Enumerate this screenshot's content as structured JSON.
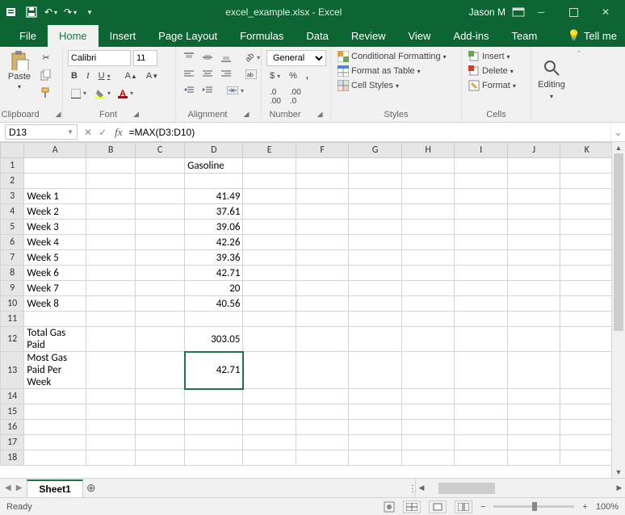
{
  "titlebar": {
    "title": "excel_example.xlsx - Excel",
    "user": "Jason M"
  },
  "tabs": {
    "file": "File",
    "home": "Home",
    "insert": "Insert",
    "pagelayout": "Page Layout",
    "formulas": "Formulas",
    "data": "Data",
    "review": "Review",
    "view": "View",
    "addins": "Add-ins",
    "team": "Team",
    "tellme": "Tell me"
  },
  "ribbon": {
    "clipboard": {
      "label": "Clipboard",
      "paste": "Paste"
    },
    "font": {
      "label": "Font",
      "name": "Calibri",
      "size": "11",
      "bold": "B",
      "italic": "I",
      "underline": "U"
    },
    "alignment": {
      "label": "Alignment"
    },
    "number": {
      "label": "Number",
      "format": "General"
    },
    "styles": {
      "label": "Styles",
      "cond": "Conditional Formatting",
      "table": "Format as Table",
      "cell": "Cell Styles"
    },
    "cells": {
      "label": "Cells",
      "insert": "Insert",
      "delete": "Delete",
      "format": "Format"
    },
    "editing": {
      "label": "Editing"
    }
  },
  "formula_bar": {
    "name_box": "D13",
    "fx": "fx",
    "formula": "=MAX(D3:D10)"
  },
  "columns": [
    "A",
    "B",
    "C",
    "D",
    "E",
    "F",
    "G",
    "H",
    "I",
    "J",
    "K"
  ],
  "rows": [
    1,
    2,
    3,
    4,
    5,
    6,
    7,
    8,
    9,
    10,
    11,
    12,
    13,
    14,
    15,
    16,
    17,
    18
  ],
  "cell_data": {
    "D1": "Gasoline",
    "A3": "Week 1",
    "D3": "41.49",
    "A4": "Week 2",
    "D4": "37.61",
    "A5": "Week 3",
    "D5": "39.06",
    "A6": "Week 4",
    "D6": "42.26",
    "A7": "Week 5",
    "D7": "39.36",
    "A8": "Week 6",
    "D8": "42.71",
    "A9": "Week 7",
    "D9": "20",
    "A10": "Week 8",
    "D10": "40.56",
    "A12": "Total Gas Paid",
    "D12": "303.05",
    "A13": "Most Gas Paid Per Week",
    "D13": "42.71"
  },
  "selected_cell": "D13",
  "sheet_tabs": {
    "active": "Sheet1"
  },
  "statusbar": {
    "ready": "Ready",
    "zoom": "100%"
  }
}
